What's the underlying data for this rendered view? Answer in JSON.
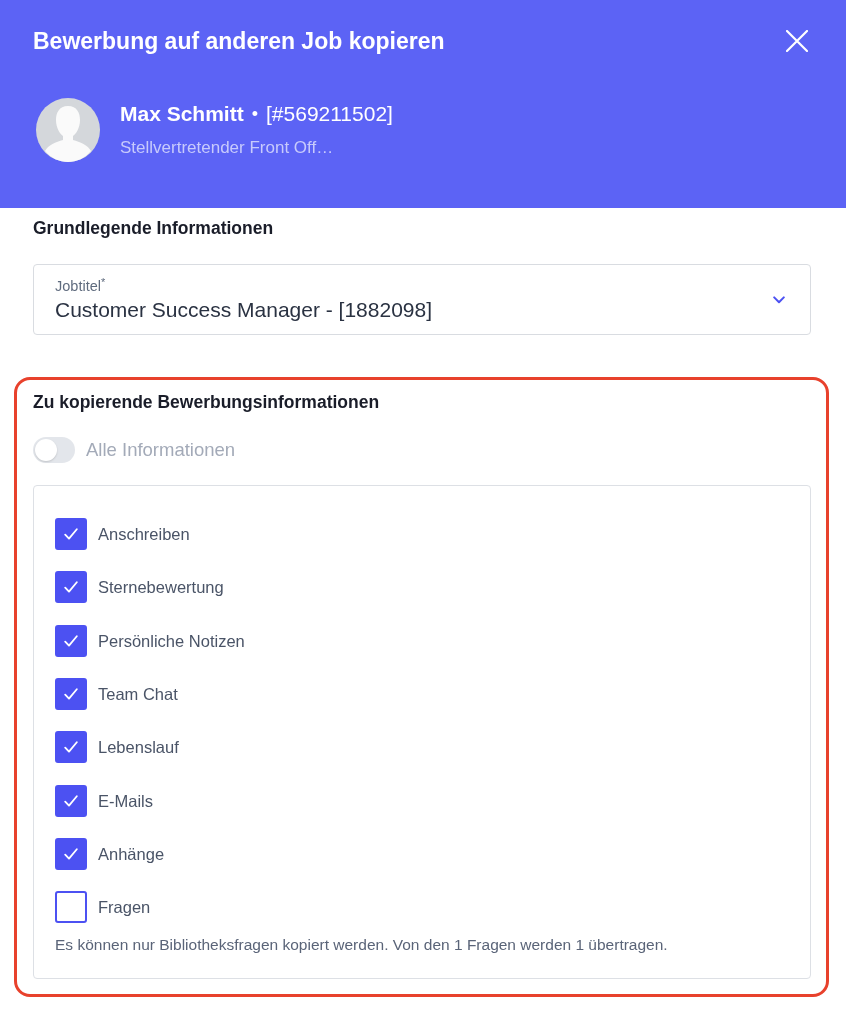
{
  "dialog": {
    "title": "Bewerbung auf anderen Job kopieren"
  },
  "candidate": {
    "name": "Max Schmitt",
    "separator": "•",
    "id": "[#569211502]",
    "subtitle": "Stellvertretender Front Off…"
  },
  "basic_info": {
    "heading": "Grundlegende Informationen",
    "job_title_field": {
      "label": "Jobtitel$^{*}$",
      "value": "Customer Success Manager - [1882098]"
    }
  },
  "copy_section": {
    "highlighted": true,
    "heading": "Zu kopierende Bewerbungsinformationen",
    "all_toggle": {
      "label": "Alle Informationen",
      "on": false,
      "disabled": true
    },
    "items": [
      {
        "label": "Anschreiben",
        "checked": true
      },
      {
        "label": "Sternebewertung",
        "checked": true
      },
      {
        "label": "Persönliche Notizen",
        "checked": true
      },
      {
        "label": "Team Chat",
        "checked": true
      },
      {
        "label": "Lebenslauf",
        "checked": true
      },
      {
        "label": "E-Mails",
        "checked": true
      },
      {
        "label": "Anhänge",
        "checked": true
      },
      {
        "label": "Fragen",
        "checked": false
      }
    ],
    "note": "Es können nur Bibliotheksfragen kopiert werden. Von den 1 Fragen werden 1 übertragen."
  }
}
